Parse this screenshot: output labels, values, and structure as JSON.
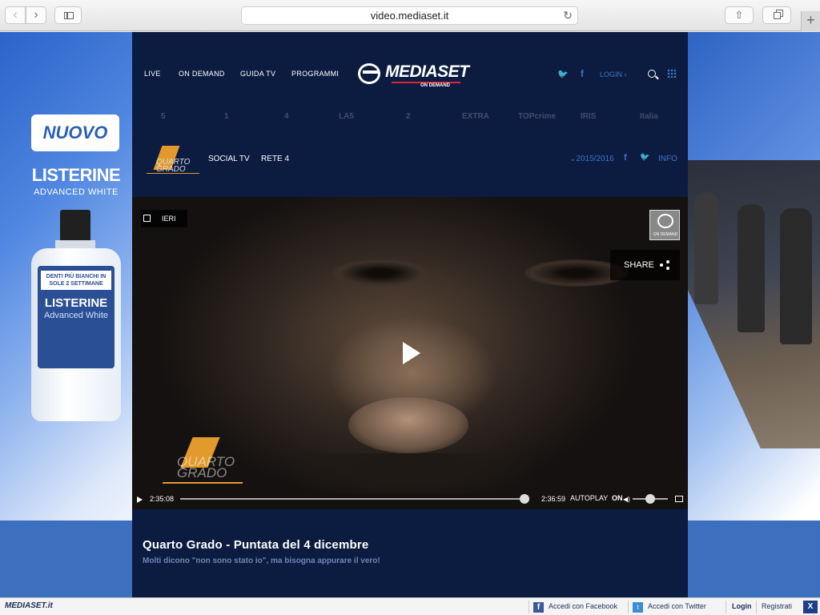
{
  "browser": {
    "url": "video.mediaset.it",
    "back": "‹",
    "forward": "›",
    "reload": "↻",
    "share": "⇧",
    "new_tab": "+"
  },
  "ad_left": {
    "badge": "NUOVO",
    "brand": "LISTERINE",
    "line": "ADVANCED WHITE",
    "bottle_claim": "DENTI PIÙ BIANCHI IN SOLE 2 SETTIMANE",
    "bottle_brand": "LISTERINE",
    "bottle_line": "Advanced White"
  },
  "site": {
    "nav": [
      "LIVE",
      "ON DEMAND",
      "GUIDA TV",
      "PROGRAMMI"
    ],
    "logo_text": "MEDIASET",
    "logo_sub": "ON DEMAND",
    "login": "LOGIN ›",
    "twitter": "🐦",
    "facebook": "f",
    "channels": [
      "5",
      "1",
      "4",
      "LA5",
      "2",
      "EXTRA",
      "TOPcrime",
      "IRIS",
      "Italia"
    ],
    "program": {
      "logo_text": "QUARTO GRADO",
      "nav": [
        "SOCIAL TV",
        "RETE 4"
      ],
      "season": "⌄2015/2016",
      "info": "INFO"
    }
  },
  "player": {
    "date_tag": "IERI",
    "od_badge": "ON DEMAND",
    "share": "SHARE",
    "watermark": "QUARTO GRADO",
    "time_current": "2:35:08",
    "time_total": "2:36:59",
    "progress": 0.987,
    "autoplay": "AUTOPLAY",
    "autoplay_state": "ON",
    "volume": 0.5
  },
  "episode": {
    "title": "Quarto Grado - Puntata del 4 dicembre",
    "description": "Molti dicono \"non sono stato io\", ma bisogna appurare il vero!"
  },
  "bottom_bar": {
    "logo": "MEDIASET.it",
    "facebook_label": "Accedi con Facebook",
    "twitter_label": "Accedi con Twitter",
    "login": "Login",
    "register": "Registrati",
    "close": "X"
  },
  "colors": {
    "site_bg": "#0c1c41",
    "accent_blue": "#3f74c8",
    "program_orange": "#e19a2b",
    "logo_red": "#d9263b"
  }
}
